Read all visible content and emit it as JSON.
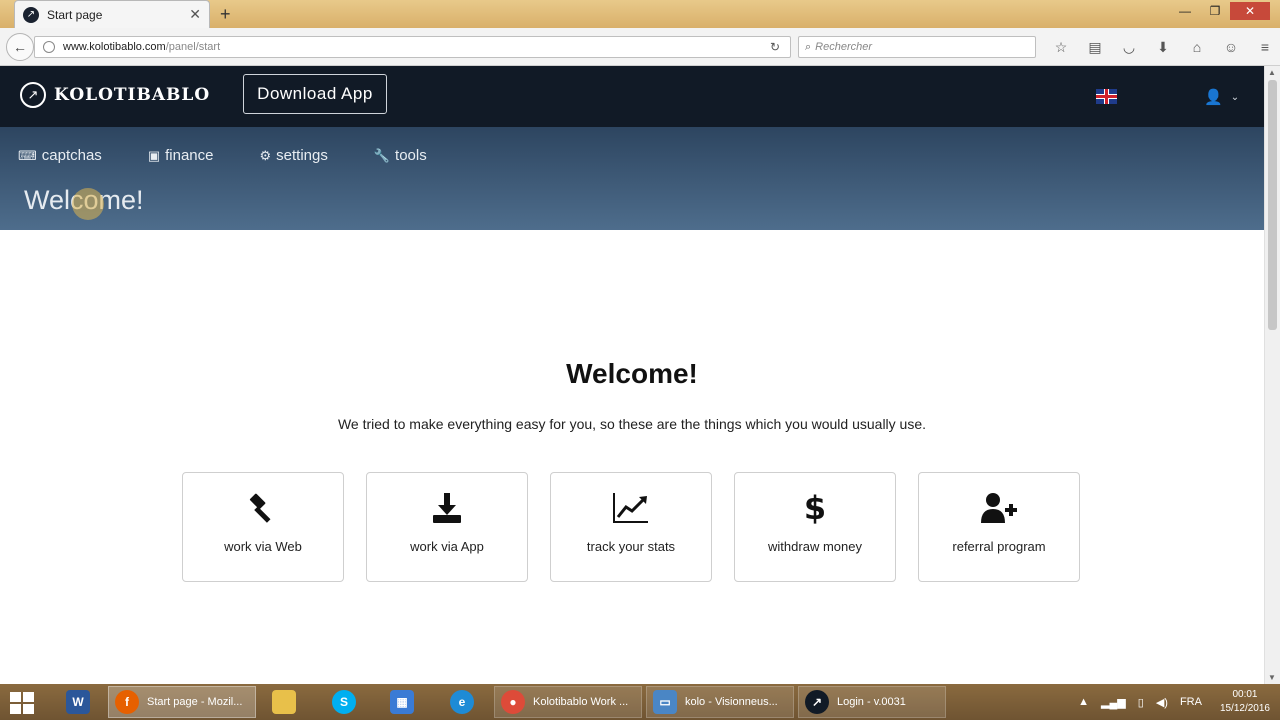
{
  "browser": {
    "tab_title": "Start page",
    "new_tab": "+",
    "url_domain": "www.kolotibablo.com",
    "url_path": "/panel/start",
    "search_placeholder": "Rechercher"
  },
  "site": {
    "logo_text": "KOLOTIBABLO",
    "download_button": "Download App",
    "menu": [
      {
        "label": "captchas",
        "icon": "keyboard-icon"
      },
      {
        "label": "finance",
        "icon": "money-icon"
      },
      {
        "label": "settings",
        "icon": "gear-icon"
      },
      {
        "label": "tools",
        "icon": "wrench-icon"
      }
    ],
    "header_welcome": "Welcome!"
  },
  "content": {
    "title": "Welcome!",
    "subtitle": "We tried to make everything easy for you, so these are the things which you would usually use.",
    "cards": [
      {
        "label": "work via Web",
        "icon": "gavel-icon"
      },
      {
        "label": "work via App",
        "icon": "download-icon"
      },
      {
        "label": "track your stats",
        "icon": "chart-icon"
      },
      {
        "label": "withdraw money",
        "icon": "dollar-icon"
      },
      {
        "label": "referral program",
        "icon": "add-user-icon"
      }
    ]
  },
  "taskbar": {
    "items": [
      {
        "label": "Start page - Mozil..."
      },
      {
        "label": "Kolotibablo Work ..."
      },
      {
        "label": "kolo - Visionneus..."
      },
      {
        "label": "Login - v.0031"
      }
    ],
    "language": "FRA",
    "time": "00:01",
    "date": "15/12/2016"
  }
}
